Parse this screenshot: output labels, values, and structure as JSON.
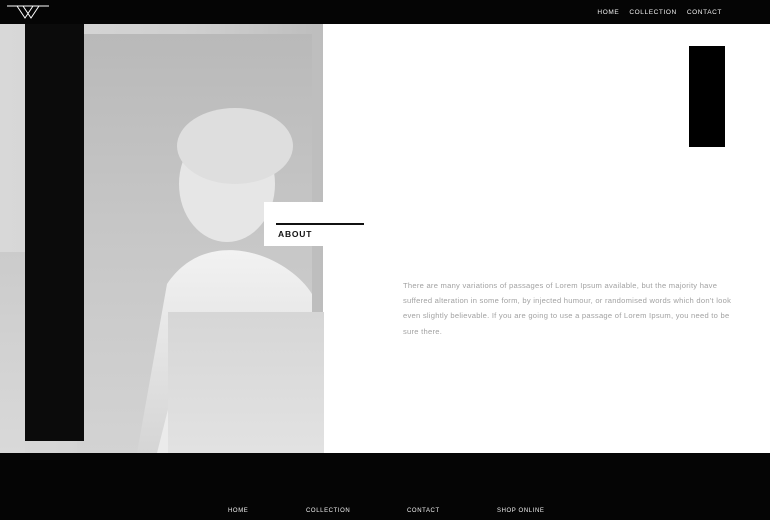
{
  "header": {
    "nav": [
      {
        "label": "HOME"
      },
      {
        "label": "COLLECTION"
      },
      {
        "label": "CONTACT"
      }
    ]
  },
  "hero": {
    "section_title": "ABOUT",
    "paragraph": "There are many variations of passages of Lorem Ipsum available, but the majority have suffered alteration in some form, by injected humour, or randomised words which don't look even slightly believable. If you are going to use a passage of Lorem Ipsum, you need to be sure there."
  },
  "footer": {
    "nav": [
      {
        "label": "HOME"
      },
      {
        "label": "COLLECTION"
      },
      {
        "label": "CONTACT"
      },
      {
        "label": "SHOP ONLINE"
      }
    ]
  },
  "colors": {
    "bar": "#050505",
    "paragraph_text": "#a2a2a2",
    "background": "#ffffff"
  },
  "icons": {
    "logo": "triangle-logo-icon"
  }
}
